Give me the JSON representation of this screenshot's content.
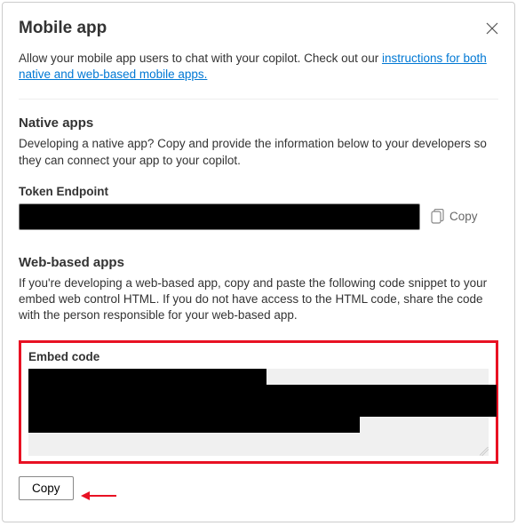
{
  "title": "Mobile app",
  "intro_text": "Allow your mobile app users to chat with your copilot. Check out our ",
  "intro_link": "instructions for both native and web-based mobile apps.",
  "native": {
    "heading": "Native apps",
    "description": "Developing a native app? Copy and provide the information below to your developers so they can connect your app to your copilot.",
    "token_label": "Token Endpoint",
    "token_value": "",
    "copy_label": "Copy"
  },
  "web": {
    "heading": "Web-based apps",
    "description": "If you're developing a web-based app, copy and paste the following code snippet to your embed web control HTML. If you do not have access to the HTML code, share the code with the person responsible for your web-based app.",
    "embed_label": "Embed code",
    "embed_value": ""
  },
  "copy_button": "Copy"
}
